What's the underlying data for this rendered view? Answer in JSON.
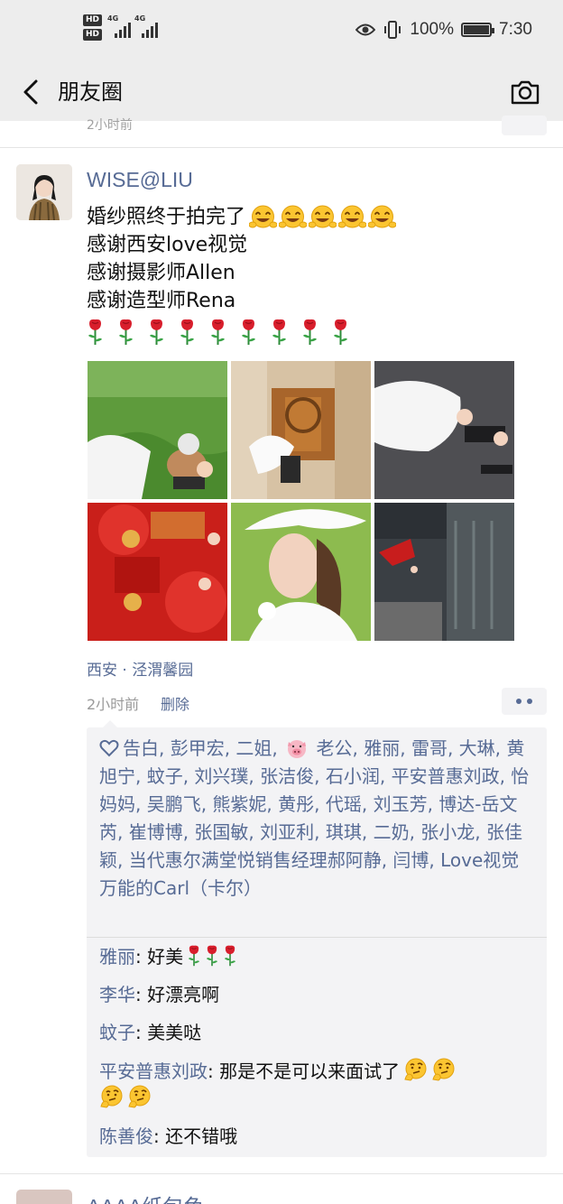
{
  "status_bar": {
    "hd1": "HD",
    "hd2": "HD",
    "net1": "4G",
    "net2": "4G",
    "battery_pct": "100%",
    "time": "7:30"
  },
  "header": {
    "title": "朋友圈",
    "back_icon": "chevron-left-icon",
    "camera_icon": "camera-icon"
  },
  "prev_post": {
    "time": "2小时前"
  },
  "post": {
    "author": "WISE@LIU",
    "lines": [
      "婚纱照终于拍完了",
      "感谢西安love视觉",
      "感谢摄影师Allen",
      "感谢造型师Rena"
    ],
    "trailing_emoji_count": 5,
    "rose_count": 9,
    "location": "西安 · 泾渭馨园",
    "time": "2小时前",
    "delete_label": "删除",
    "likes_text_a": "告白, 彭甲宏, 二姐,",
    "likes_text_b": "老公, 雅丽, 雷哥, 大琳, 黄旭宁, 蚊子, 刘兴璞, 张洁俊, 石小润, 平安普惠刘政, 怡妈妈, 吴鹏飞, 熊紫妮, 黄彤, 代瑶, 刘玉芳, 博达-岳文芮, 崔博博, 张国敏, 刘亚利, 琪琪, 二奶, 张小龙, 张佳颖, 当代惠尔满堂悦销售经理郝阿静, 闫博, Love视觉万能的Carl（卡尔）",
    "comments": [
      {
        "author": "雅丽",
        "sep": ": ",
        "text": "好美"
      },
      {
        "author": "李华",
        "sep": ": ",
        "text": "好漂亮啊"
      },
      {
        "author": "蚊子",
        "sep": ": ",
        "text": "美美哒"
      },
      {
        "author": "平安普惠刘政",
        "sep": ": ",
        "text": "那是不是可以来面试了"
      },
      {
        "author": "陈善俊",
        "sep": ": ",
        "text": "还不错哦"
      }
    ]
  },
  "next_post": {
    "author": "AAAA纸包鱼"
  },
  "colors": {
    "link": "#576b95",
    "header_bg": "#ededed",
    "panel_bg": "#f3f3f5"
  }
}
